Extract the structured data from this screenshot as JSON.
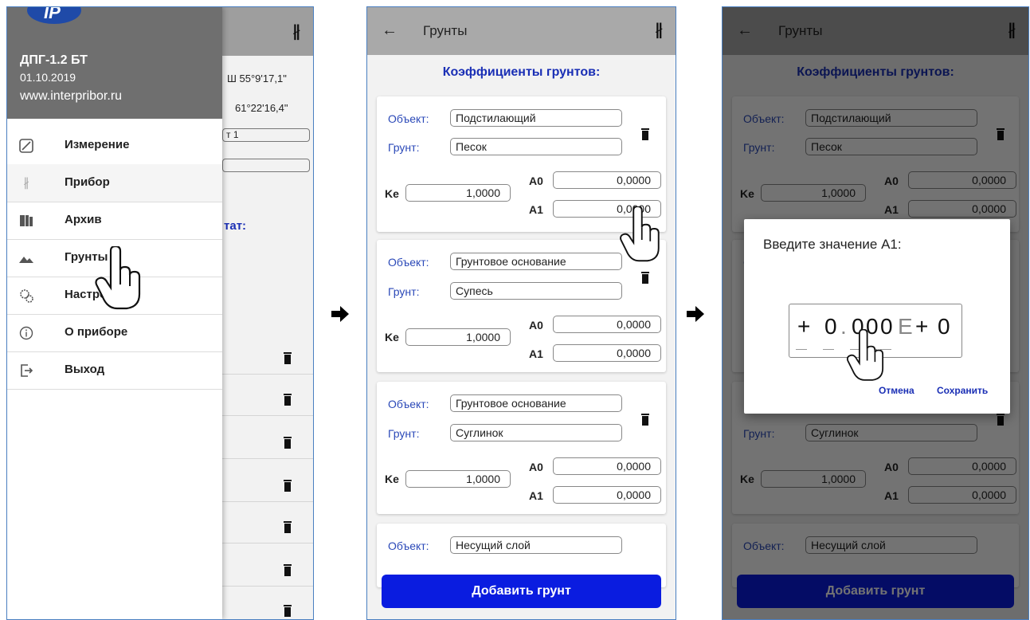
{
  "colors": {
    "accent_blue": "#1a2fb5",
    "button_blue": "#0a1ce0",
    "appbar_grey": "#a9a9a9",
    "drawer_header": "#6f6f6f"
  },
  "panel1": {
    "drawer": {
      "device_name": "ДПГ-1.2 БТ",
      "date": "01.10.2019",
      "website": "www.interpribor.ru",
      "items": [
        {
          "label": "Измерение",
          "icon": "ruler-icon"
        },
        {
          "label": "Прибор",
          "icon": "bluetooth-icon"
        },
        {
          "label": "Архив",
          "icon": "archive-icon"
        },
        {
          "label": "Грунты",
          "icon": "mountain-icon"
        },
        {
          "label": "Настройки",
          "icon": "gears-icon"
        },
        {
          "label": "О приборе",
          "icon": "info-icon"
        },
        {
          "label": "Выход",
          "icon": "exit-icon"
        }
      ]
    },
    "background": {
      "lat": "Ш 55°9'17,1\"",
      "lon": "61°22'16,4\"",
      "field_text": "т 1",
      "result_label": "тат:"
    }
  },
  "panel2": {
    "appbar_title": "Грунты",
    "section_title": "Коэффициенты грунтов:",
    "labels": {
      "object": "Объект:",
      "soil": "Грунт:",
      "ke": "Ke",
      "a0": "A0",
      "a1": "A1"
    },
    "cards": [
      {
        "object": "Подстилающий",
        "soil": "Песок",
        "ke": "1,0000",
        "a0": "0,0000",
        "a1": "0,0000"
      },
      {
        "object": "Грунтовое основание",
        "soil": "Супесь",
        "ke": "1,0000",
        "a0": "0,0000",
        "a1": "0,0000"
      },
      {
        "object": "Грунтовое основание",
        "soil": "Суглинок",
        "ke": "1,0000",
        "a0": "0,0000",
        "a1": "0,0000"
      },
      {
        "object": "Несущий слой"
      }
    ],
    "add_button": "Добавить грунт"
  },
  "panel3": {
    "dialog": {
      "title": "Введите значение A1:",
      "digits": [
        "+",
        "0",
        ".",
        "0",
        "0",
        "0",
        "E",
        "+",
        "0"
      ],
      "cancel": "Отмена",
      "save": "Сохранить"
    }
  }
}
